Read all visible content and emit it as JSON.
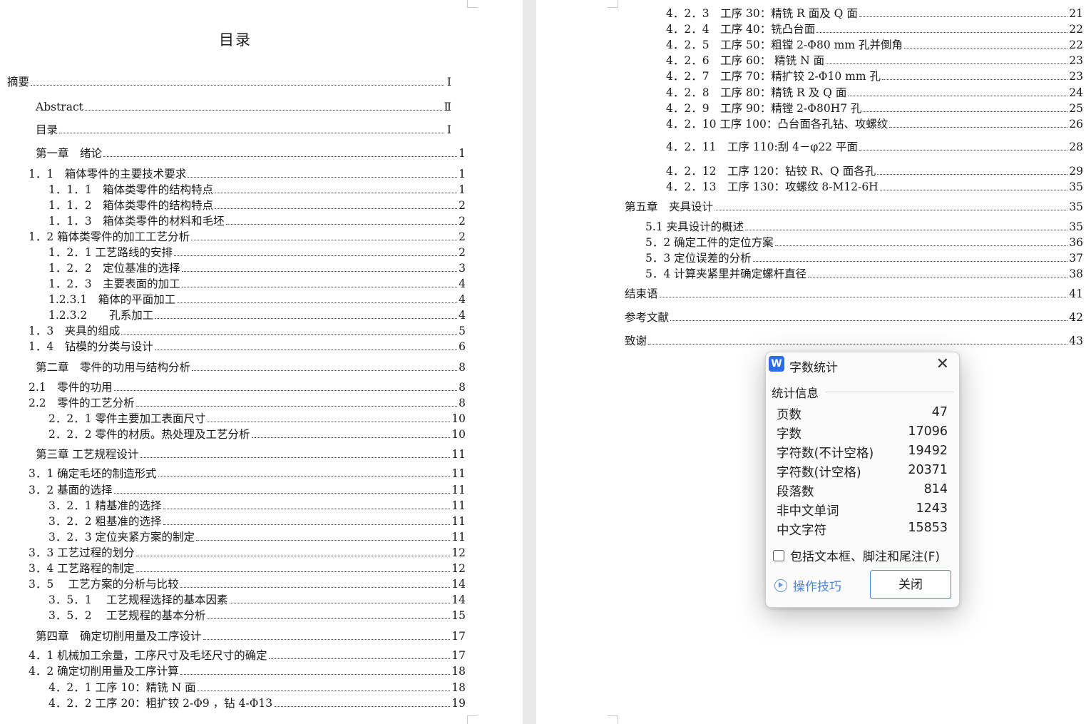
{
  "left_page": {
    "title": "目录",
    "entries": [
      {
        "text": "摘要",
        "page": "Ⅰ"
      },
      {
        "text": "Abstract",
        "page": "Ⅱ"
      },
      {
        "text": "目录",
        "page": "Ⅰ"
      },
      {
        "text": "第一章　绪论",
        "page": "1"
      },
      {
        "text": "1．1　箱体零件的主要技术要求",
        "page": "1"
      },
      {
        "text": "1．1．1　箱体类零件的结构特点",
        "page": "1"
      },
      {
        "text": "1．1．2　箱体类零件的结构特点",
        "page": "2"
      },
      {
        "text": "1．1．3　箱体类零件的材料和毛坯",
        "page": "2"
      },
      {
        "text": "1．2 箱体类零件的加工工艺分析",
        "page": "2"
      },
      {
        "text": "1．2．1 工艺路线的安排",
        "page": "2"
      },
      {
        "text": "1．2．2　定位基准的选择",
        "page": "3"
      },
      {
        "text": "1．2．3　主要表面的加工",
        "page": "4"
      },
      {
        "text": "1.2.3.1　箱体的平面加工",
        "page": "4"
      },
      {
        "text": "1.2.3.2　　孔系加工",
        "page": "4"
      },
      {
        "text": "1．3　夹具的组成",
        "page": "5"
      },
      {
        "text": "1．4　钻模的分类与设计",
        "page": "6"
      },
      {
        "text": "第二章　零件的功用与结构分析",
        "page": "8"
      },
      {
        "text": "2.1　零件的功用",
        "page": "8"
      },
      {
        "text": "2.2　零件的工艺分析",
        "page": "8"
      },
      {
        "text": "2．2．1 零件主要加工表面尺寸",
        "page": "10"
      },
      {
        "text": "2．2．2 零件的材质。热处理及工艺分析",
        "page": "10"
      },
      {
        "text": "第三章  工艺规程设计",
        "page": "11"
      },
      {
        "text": "3．1  确定毛坯的制造形式",
        "page": "11"
      },
      {
        "text": "3．2 基面的选择",
        "page": "11"
      },
      {
        "text": "3．2．1  精基准的选择",
        "page": "11"
      },
      {
        "text": "3．2．2  粗基准的选择",
        "page": "11"
      },
      {
        "text": "3．2．3  定位夹紧方案的制定",
        "page": "11"
      },
      {
        "text": "3．3 工艺过程的划分",
        "page": "12"
      },
      {
        "text": "3．4 工艺路程的制定",
        "page": "12"
      },
      {
        "text": "3．5　 工艺方案的分析与比较",
        "page": "14"
      },
      {
        "text": "3．5．1　 工艺规程选择的基本因素",
        "page": "14"
      },
      {
        "text": "3．5．2　 工艺规程的基本分析",
        "page": "15"
      },
      {
        "text": "第四章　确定切削用量及工序设计",
        "page": "17"
      },
      {
        "text": "4．1  机械加工余量，工序尺寸及毛坯尺寸的确定",
        "page": "17"
      },
      {
        "text": "4．2  确定切削用量及工序计算",
        "page": "18"
      },
      {
        "text": "4．2．1 工序 10：精铣 N 面",
        "page": "18"
      },
      {
        "text": "4．2．2 工序 20：粗扩铰 2-Φ9 ，钻 4-Φ13",
        "page": "19"
      }
    ]
  },
  "right_page": {
    "entries": [
      {
        "text": "4．2．3　工序 30：精铣 R 面及 Q 面",
        "page": "21"
      },
      {
        "text": "4．2．4　工序 40：铣凸台面",
        "page": "22"
      },
      {
        "text": "4．2．5　工序 50：粗镗 2-Φ80 mm 孔并倒角",
        "page": "22"
      },
      {
        "text": "4．2．6　工序 60：  精铣 N 面",
        "page": "23"
      },
      {
        "text": "4．2．7　工序 70：精扩铰 2-Φ10 mm 孔",
        "page": "23"
      },
      {
        "text": "4．2．8　工序 80：精铣 R 及 Q 面",
        "page": "24"
      },
      {
        "text": "4．2．9　工序 90：精镗 2-Φ80H7 孔",
        "page": "25"
      },
      {
        "text": "4．2．10  工序 100：凸台面各孔钻、攻螺纹",
        "page": "26"
      },
      {
        "text": "4．2．11　工序 110:刮 4－φ22 平面",
        "page": "28"
      },
      {
        "text": "4．2．12　工序 120：钻铰 R、Q 面各孔",
        "page": "29"
      },
      {
        "text": "4．2．13　工序 130：攻螺纹 8-M12-6H",
        "page": "35"
      },
      {
        "text": "第五章　夹具设计",
        "page": "35"
      },
      {
        "text": "5.1  夹具设计的概述",
        "page": "35"
      },
      {
        "text": "5．2 确定工件的定位方案",
        "page": "36"
      },
      {
        "text": "5．3 定位误差的分析",
        "page": "37"
      },
      {
        "text": "5．4 计算夹紧里并确定螺杆直径",
        "page": "38"
      },
      {
        "text": "结束语",
        "page": "41"
      },
      {
        "text": "参考文献",
        "page": "42"
      },
      {
        "text": "致谢",
        "page": "43"
      }
    ]
  },
  "dialog": {
    "logo": "W",
    "title": "字数统计",
    "close_glyph": "✕",
    "section": "统计信息",
    "stats": [
      {
        "label": "页数",
        "value": "47"
      },
      {
        "label": "字数",
        "value": "17096"
      },
      {
        "label": "字符数(不计空格)",
        "value": "19492"
      },
      {
        "label": "字符数(计空格)",
        "value": "20371"
      },
      {
        "label": "段落数",
        "value": "814"
      },
      {
        "label": "非中文单词",
        "value": "1243"
      },
      {
        "label": "中文字符",
        "value": "15853"
      }
    ],
    "checkbox_label": "包括文本框、脚注和尾注(F)",
    "checkbox_checked": false,
    "tips_label": "操作技巧",
    "close_button": "关闭",
    "accent_color": "#4a86d8",
    "logo_color": "#2b6de8"
  }
}
